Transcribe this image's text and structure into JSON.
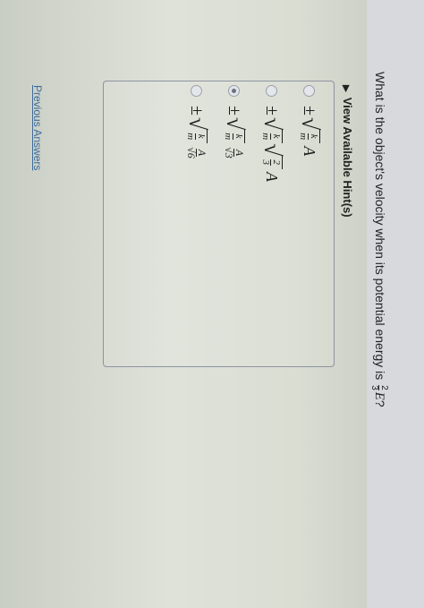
{
  "question": {
    "text": "What is the object's velocity when its potential energy is",
    "fraction_num": "2",
    "fraction_den": "3",
    "variable": "E",
    "suffix": "?"
  },
  "hints": {
    "label": "View Available Hint(s)"
  },
  "options": [
    {
      "pm": "±",
      "k": "k",
      "m": "m",
      "extra_num": "",
      "extra_den": "",
      "A": "A",
      "selected": false
    },
    {
      "pm": "±",
      "k": "k",
      "m": "m",
      "extra_num": "2",
      "extra_den": "3",
      "A": "A",
      "selected": false
    },
    {
      "pm": "±",
      "k": "k",
      "m": "m",
      "extra_num": "A",
      "extra_den": "√3",
      "A": "",
      "selected": true
    },
    {
      "pm": "±",
      "k": "k",
      "m": "m",
      "extra_num": "A",
      "extra_den": "√6",
      "A": "",
      "selected": false
    }
  ],
  "links": {
    "previous_answers": "Previous Answers"
  }
}
